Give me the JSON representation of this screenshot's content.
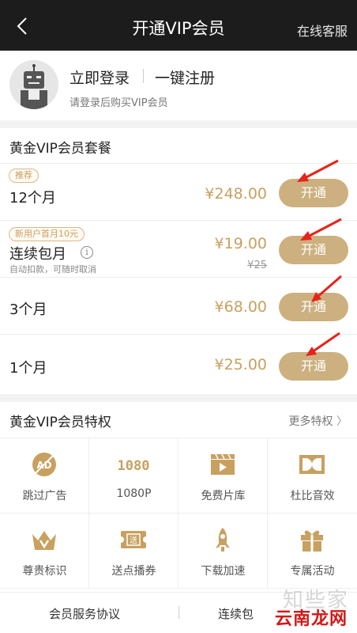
{
  "header": {
    "title": "开通VIP会员",
    "service": "在线客服"
  },
  "login": {
    "login_label": "立即登录",
    "register_label": "一键注册",
    "hint": "请登录后购买VIP会员"
  },
  "plans": {
    "title": "黄金VIP会员套餐",
    "button_label": "开通",
    "items": [
      {
        "tag": "推荐",
        "name": "12个月",
        "price": "¥248.00"
      },
      {
        "tag": "新用户首月10元",
        "name": "连续包月",
        "note": "自动扣款，可随时取消",
        "price": "¥19.00",
        "old_price": "¥25"
      },
      {
        "name": "3个月",
        "price": "¥68.00"
      },
      {
        "name": "1个月",
        "price": "¥25.00"
      }
    ]
  },
  "privileges": {
    "title": "黄金VIP会员特权",
    "more": "更多特权",
    "ad_icon_text": "AD",
    "hd_icon_text": "1080",
    "ticket_icon_text": "送",
    "items": [
      {
        "label": "跳过广告",
        "icon": "skip-ad-icon"
      },
      {
        "label": "1080P",
        "icon": "hd-1080-icon"
      },
      {
        "label": "免费片库",
        "icon": "film-library-icon"
      },
      {
        "label": "杜比音效",
        "icon": "dolby-icon"
      },
      {
        "label": "尊贵标识",
        "icon": "crown-icon"
      },
      {
        "label": "送点播券",
        "icon": "ticket-icon"
      },
      {
        "label": "下载加速",
        "icon": "rocket-icon"
      },
      {
        "label": "专属活动",
        "icon": "gift-icon"
      }
    ]
  },
  "footer": {
    "agreement": "会员服务协议",
    "second_link": "连续包"
  },
  "watermark": {
    "top": "知些家",
    "bottom": "云南龙网"
  },
  "colors": {
    "gold": "#ccb07f",
    "price": "#c8a060",
    "topbar": "#1c1c1c",
    "arrow": "#e8231a"
  }
}
